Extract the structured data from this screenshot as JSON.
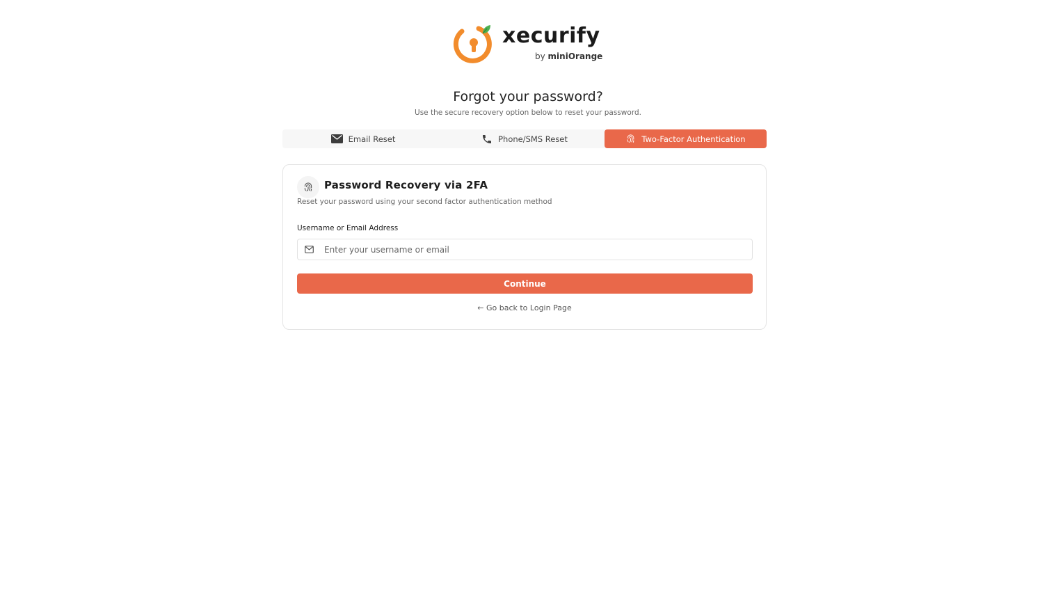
{
  "brand": {
    "name": "xecurify",
    "byline_prefix": "by",
    "byline_brand": "miniOrange",
    "accent_color": "#e9684a",
    "logo_orange": "#f28c2c",
    "logo_leaf": "#4caf50"
  },
  "header": {
    "title": "Forgot your password?",
    "subtitle": "Use the secure recovery option below to reset your password."
  },
  "tabs": [
    {
      "label": "Email Reset",
      "icon": "envelope-icon",
      "active": false
    },
    {
      "label": "Phone/SMS Reset",
      "icon": "phone-icon",
      "active": false
    },
    {
      "label": "Two-Factor Authentication",
      "icon": "fingerprint-icon",
      "active": true
    }
  ],
  "card": {
    "icon": "fingerprint-icon",
    "title": "Password Recovery via 2FA",
    "subtitle": "Reset your password using your second factor authentication method",
    "field_label": "Username or Email Address",
    "input": {
      "value": "",
      "placeholder": "Enter your username or email",
      "icon": "mail-outline-icon"
    },
    "continue_label": "Continue",
    "back_label": "Go back to Login Page",
    "back_arrow": "←"
  }
}
